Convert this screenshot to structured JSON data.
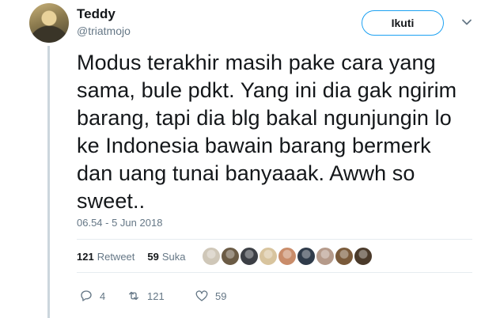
{
  "author": {
    "display_name": "Teddy",
    "handle": "@triatmojo"
  },
  "follow_button": {
    "label": "Ikuti"
  },
  "tweet": {
    "lines": [
      "Modus terakhir masih pake cara yang",
      "sama, bule pdkt. Yang ini dia gak ngirim",
      "barang, tapi dia blg bakal ngunjungin lo",
      "ke Indonesia bawain barang bermerk",
      "dan uang tunai banyaaak. Awwh so",
      "sweet.."
    ],
    "timestamp": "06.54 - 5 Jun 2018"
  },
  "stats": {
    "retweet_count": "121",
    "retweet_label": "Retweet",
    "like_count": "59",
    "like_label": "Suka"
  },
  "likers": [
    {
      "icon": "liker-avatar",
      "color": "#cfc7b8"
    },
    {
      "icon": "liker-avatar",
      "color": "#6b5b45"
    },
    {
      "icon": "liker-avatar",
      "color": "#3c3f45"
    },
    {
      "icon": "liker-avatar",
      "color": "#d8c49e"
    },
    {
      "icon": "liker-avatar",
      "color": "#c98c6a"
    },
    {
      "icon": "liker-avatar",
      "color": "#2f3b4a"
    },
    {
      "icon": "liker-avatar",
      "color": "#b59a8a"
    },
    {
      "icon": "liker-avatar",
      "color": "#7a5a3a"
    },
    {
      "icon": "liker-avatar",
      "color": "#4a3a2a"
    }
  ],
  "actions": {
    "reply_count": "4",
    "retweet_count": "121",
    "like_count": "59"
  },
  "colors": {
    "accent": "#1da1f2",
    "secondary_text": "#657786",
    "primary_text": "#14171a"
  }
}
